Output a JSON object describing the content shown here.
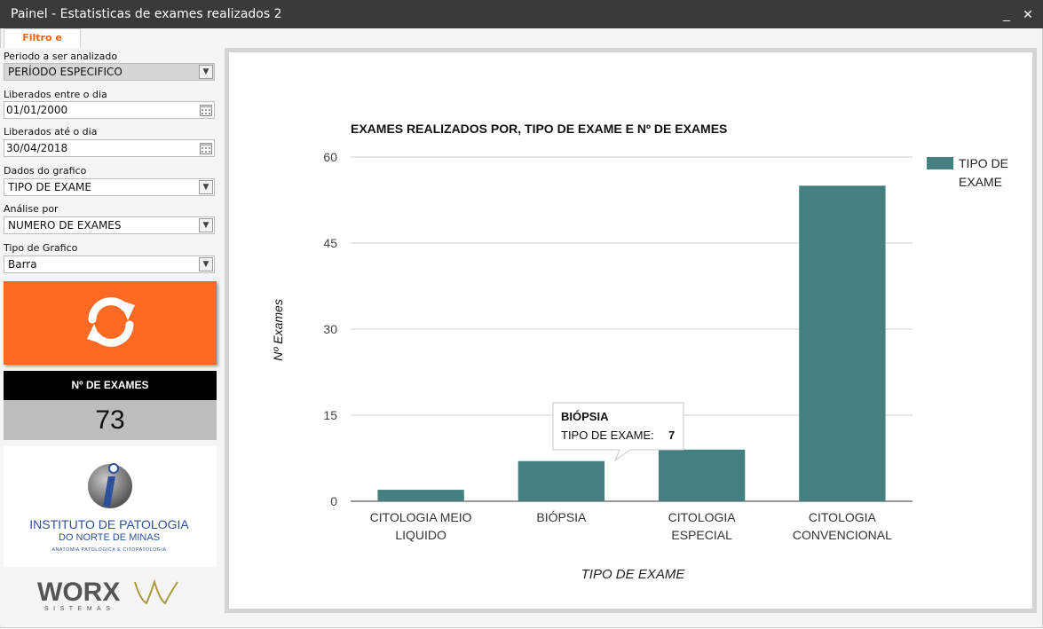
{
  "window": {
    "title": "Painel - Estatisticas de exames realizados 2",
    "minimize": "_",
    "close": "✕"
  },
  "tab": {
    "label": "Filtro e Grafico"
  },
  "filters": {
    "period_label": "Periodo a ser analizado",
    "period_value": "PERÍODO ESPECIFICO",
    "from_label": "Liberados entre o dia",
    "from_value": "01/01/2000",
    "to_label": "Liberados até o dia",
    "to_value": "30/04/2018",
    "data_label": "Dados do grafico",
    "data_value": "TIPO DE EXAME",
    "analysis_label": "Análise por",
    "analysis_value": "NUMERO DE EXAMES",
    "chart_type_label": "Tipo de Grafico",
    "chart_type_value": "Barra"
  },
  "icons": {
    "refresh": "refresh-icon",
    "calendar": "calendar-icon",
    "dropdown": "chevron-down-icon"
  },
  "summary": {
    "header": "Nº DE EXAMES",
    "value": "73"
  },
  "logo": {
    "line1": "INSTITUTO DE PATOLOGIA",
    "line2": "DO NORTE DE MINAS",
    "line3": "ANATOMIA PATOLOGICA E CITOPATOLOGIA"
  },
  "vendor": {
    "name": "WORX",
    "sub": "SISTEMAS"
  },
  "colors": {
    "accent": "#fd6a23",
    "bar": "#43807f",
    "tab_text": "#e8641d"
  },
  "chart_data": {
    "type": "bar",
    "title": "EXAMES REALIZADOS POR, TIPO DE EXAME E Nº DE EXAMES",
    "xlabel": "TIPO DE EXAME",
    "ylabel": "Nº Exames",
    "ylim": [
      0,
      60
    ],
    "yticks": [
      "0",
      "15",
      "30",
      "45",
      "60"
    ],
    "categories": [
      [
        "CITOLOGIA MEIO",
        "LIQUIDO"
      ],
      [
        "BIÓPSIA"
      ],
      [
        "CITOLOGIA",
        "ESPECIAL"
      ],
      [
        "CITOLOGIA",
        "CONVENCIONAL"
      ]
    ],
    "series": [
      {
        "name": "TIPO DE EXAME",
        "values": [
          2,
          7,
          9,
          55
        ]
      }
    ],
    "legend": {
      "position": "top-right",
      "lines": [
        "TIPO DE",
        "EXAME"
      ]
    },
    "tooltip": {
      "category": "BIÓPSIA",
      "label": "TIPO DE EXAME:",
      "value": "7"
    },
    "grid": true
  }
}
